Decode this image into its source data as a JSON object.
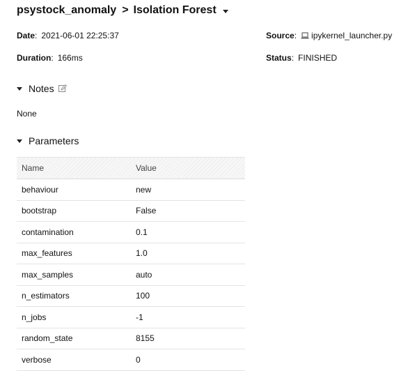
{
  "breadcrumb": {
    "experiment": "psystock_anomaly",
    "separator": ">",
    "run_name": "Isolation Forest"
  },
  "meta": {
    "date_label": "Date",
    "date_value": "2021-06-01 22:25:37",
    "duration_label": "Duration",
    "duration_value": "166ms",
    "source_label": "Source",
    "source_value": "ipykernel_launcher.py",
    "status_label": "Status",
    "status_value": "FINISHED"
  },
  "notes": {
    "title": "Notes",
    "body": "None"
  },
  "parameters": {
    "title": "Parameters",
    "columns": [
      "Name",
      "Value"
    ],
    "rows": [
      {
        "name": "behaviour",
        "value": "new"
      },
      {
        "name": "bootstrap",
        "value": "False"
      },
      {
        "name": "contamination",
        "value": "0.1"
      },
      {
        "name": "max_features",
        "value": "1.0"
      },
      {
        "name": "max_samples",
        "value": "auto"
      },
      {
        "name": "n_estimators",
        "value": "100"
      },
      {
        "name": "n_jobs",
        "value": "-1"
      },
      {
        "name": "random_state",
        "value": "8155"
      },
      {
        "name": "verbose",
        "value": "0"
      }
    ]
  }
}
